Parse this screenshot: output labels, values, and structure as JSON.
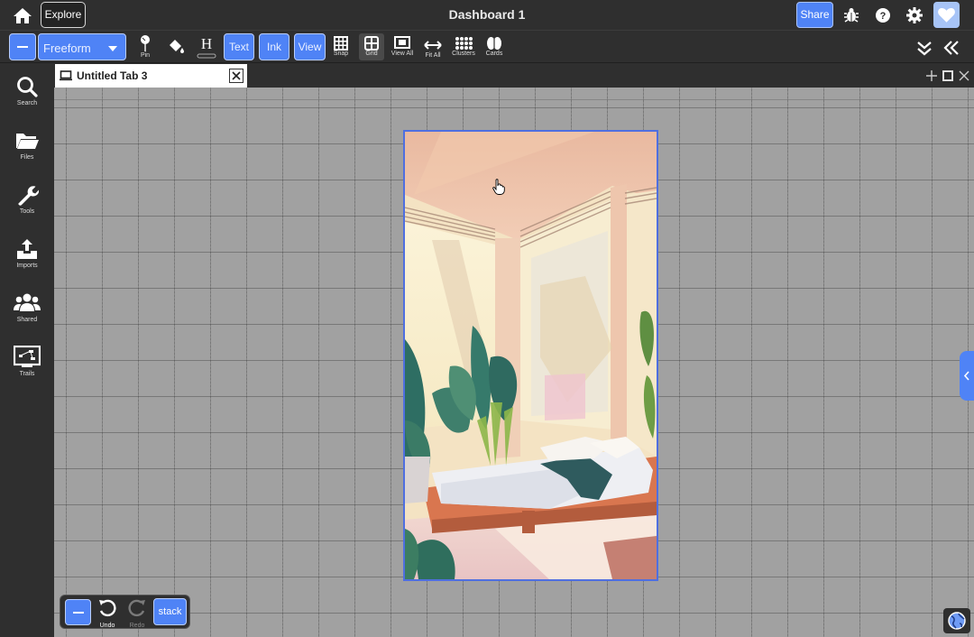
{
  "app": {
    "title": "Dashboard 1",
    "explore_label": "Explore",
    "share_label": "Share"
  },
  "toolbar": {
    "mode": "Freeform",
    "pin_label": "Pin",
    "text_label": "Text",
    "ink_label": "Ink",
    "view_label": "View",
    "snap_label": "Snap",
    "grid_label": "Grid",
    "view_all_label": "View All",
    "fit_all_label": "Fit All",
    "clusters_label": "Clusters",
    "cards_label": "Cards"
  },
  "sidebar": {
    "items": [
      {
        "label": "Search",
        "icon": "search-icon"
      },
      {
        "label": "Files",
        "icon": "folder-icon"
      },
      {
        "label": "Tools",
        "icon": "wrench-icon"
      },
      {
        "label": "Imports",
        "icon": "upload-icon"
      },
      {
        "label": "Shared",
        "icon": "users-icon"
      },
      {
        "label": "Trails",
        "icon": "presentation-icon"
      }
    ]
  },
  "tabs": [
    {
      "label": "Untitled Tab 3",
      "active": true
    }
  ],
  "bottom_bar": {
    "undo_label": "Undo",
    "redo_label": "Redo",
    "stack_label": "stack"
  },
  "colors": {
    "accent": "#4f83f6",
    "chrome": "#2f2f2f",
    "canvas": "#a1a1a1",
    "selection": "#4f6fe0"
  }
}
